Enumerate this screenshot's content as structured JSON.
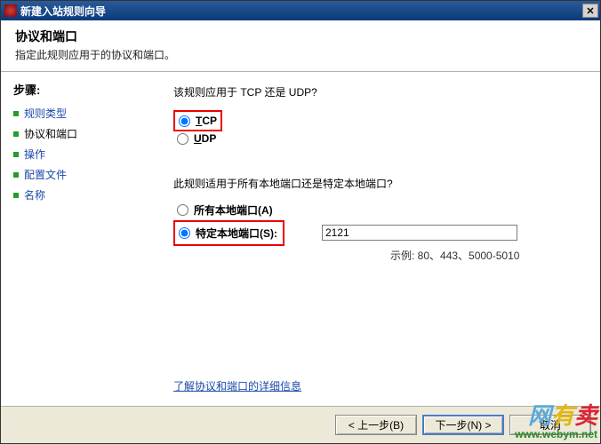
{
  "title": "新建入站规则向导",
  "header": {
    "title": "协议和端口",
    "subtitle": "指定此规则应用于的协议和端口。"
  },
  "sidebar": {
    "heading": "步骤:",
    "items": [
      {
        "label": "规则类型"
      },
      {
        "label": "协议和端口"
      },
      {
        "label": "操作"
      },
      {
        "label": "配置文件"
      },
      {
        "label": "名称"
      }
    ]
  },
  "main": {
    "q1": "该规则应用于 TCP 还是 UDP?",
    "tcp_prefix": "T",
    "tcp_rest": "CP",
    "udp_prefix": "U",
    "udp_rest": "DP",
    "q2": "此规则适用于所有本地端口还是特定本地端口?",
    "all_ports_label": "所有本地端口(A)",
    "specific_ports_label": "特定本地端口(S):",
    "port_value": "2121",
    "example": "示例: 80、443、5000-5010",
    "learn_more": "了解协议和端口的详细信息"
  },
  "footer": {
    "back": "< 上一步(B)",
    "next": "下一步(N) >",
    "cancel": "取消"
  },
  "watermark": {
    "c1": "网",
    "c2": "有",
    "c3": "卖",
    "url": "www.webym.net"
  },
  "colors": {
    "wm1": "#5aa9dd",
    "wm2": "#e2b814",
    "wm3": "#d23"
  }
}
